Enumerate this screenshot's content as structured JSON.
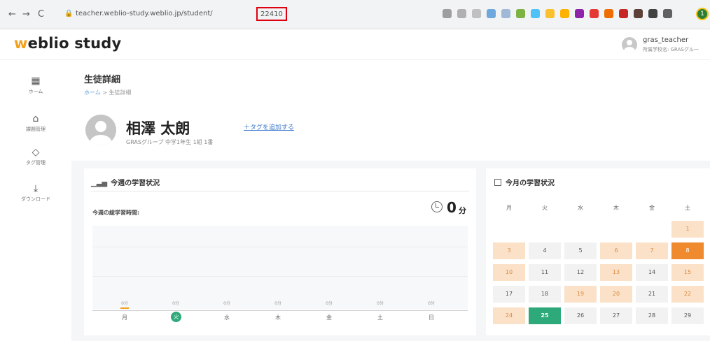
{
  "browser": {
    "back": "←",
    "forward": "→",
    "reload": "C",
    "url": "teacher.weblio-study.weblio.jp/student/",
    "url_highlighted": "22410",
    "profile": "1"
  },
  "header": {
    "logo_w": "w",
    "logo_rest": "eblio study",
    "user_name": "gras_teacher",
    "user_org": "所属学校名: GRASグル一"
  },
  "sidebar": {
    "items": [
      {
        "icon": "▦",
        "label": "ホーム"
      },
      {
        "icon": "⌂",
        "label": "課題管理"
      },
      {
        "icon": "◇",
        "label": "タグ管理"
      },
      {
        "icon": "⤓",
        "label": "ダウンロード"
      }
    ]
  },
  "page": {
    "title": "生徒詳細",
    "breadcrumb_home": "ホーム",
    "breadcrumb_sep": ">",
    "breadcrumb_current": "生徒詳細"
  },
  "student": {
    "name": "相澤 太朗",
    "info": "GRASグループ 中学1年生 1組 1番",
    "add_tag": "＋タグを追加する"
  },
  "weekly": {
    "title": "今週の学習状況",
    "icon": "📊",
    "subtitle": "今週の総学習時間:",
    "total": "0",
    "unit": "分",
    "days": [
      {
        "label": "月",
        "value": "0分",
        "today": false
      },
      {
        "label": "火",
        "value": "0分",
        "today": true
      },
      {
        "label": "水",
        "value": "0分",
        "today": false
      },
      {
        "label": "木",
        "value": "0分",
        "today": false
      },
      {
        "label": "金",
        "value": "0分",
        "today": false
      },
      {
        "label": "土",
        "value": "0分",
        "today": false
      },
      {
        "label": "日",
        "value": "0分",
        "today": false
      }
    ]
  },
  "monthly": {
    "title": "今月の学習状況",
    "dow": [
      "月",
      "火",
      "水",
      "木",
      "金",
      "土"
    ],
    "rows": [
      [
        null,
        null,
        null,
        null,
        null,
        {
          "d": "1",
          "s": "light"
        }
      ],
      [
        {
          "d": "3",
          "s": "light"
        },
        {
          "d": "4",
          "s": ""
        },
        {
          "d": "5",
          "s": ""
        },
        {
          "d": "6",
          "s": "light"
        },
        {
          "d": "7",
          "s": "light"
        },
        {
          "d": "8",
          "s": "strong"
        }
      ],
      [
        {
          "d": "10",
          "s": "light"
        },
        {
          "d": "11",
          "s": ""
        },
        {
          "d": "12",
          "s": ""
        },
        {
          "d": "13",
          "s": "light"
        },
        {
          "d": "14",
          "s": ""
        },
        {
          "d": "15",
          "s": "light"
        }
      ],
      [
        {
          "d": "17",
          "s": ""
        },
        {
          "d": "18",
          "s": ""
        },
        {
          "d": "19",
          "s": "light"
        },
        {
          "d": "20",
          "s": "light"
        },
        {
          "d": "21",
          "s": ""
        },
        {
          "d": "22",
          "s": "light"
        }
      ],
      [
        {
          "d": "24",
          "s": "light"
        },
        {
          "d": "25",
          "s": "today"
        },
        {
          "d": "26",
          "s": ""
        },
        {
          "d": "27",
          "s": ""
        },
        {
          "d": "28",
          "s": ""
        },
        {
          "d": "29",
          "s": ""
        }
      ]
    ]
  },
  "colors": {
    "accent": "#f4a01b",
    "today": "#2ea97a",
    "study_light": "#fbe1c8",
    "study_strong": "#ef8a2e",
    "highlight_box": "#e0000f"
  }
}
